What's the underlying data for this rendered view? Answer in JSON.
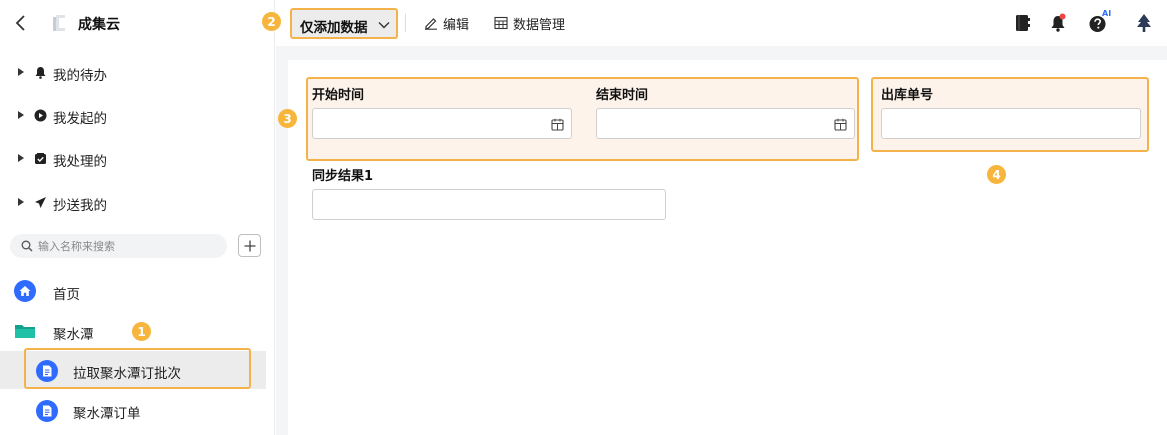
{
  "app": {
    "name": "成集云"
  },
  "sidebar": {
    "groups": [
      {
        "label": "我的待办",
        "icon": "bell-icon"
      },
      {
        "label": "我发起的",
        "icon": "play-circle-icon"
      },
      {
        "label": "我处理的",
        "icon": "check-box-icon"
      },
      {
        "label": "抄送我的",
        "icon": "send-icon"
      }
    ],
    "search": {
      "placeholder": "输入名称来搜索",
      "value": ""
    },
    "home_label": "首页",
    "folder_label": "聚水潭",
    "items": [
      {
        "label": "拉取聚水潭订批次",
        "selected": true
      },
      {
        "label": "聚水潭订单",
        "selected": false
      }
    ]
  },
  "toolbar": {
    "view_label": "仅添加数据",
    "edit_label": "编辑",
    "data_manage_label": "数据管理",
    "ai_badge": "AI"
  },
  "form": {
    "start_time": {
      "label": "开始时间",
      "value": ""
    },
    "end_time": {
      "label": "结束时间",
      "value": ""
    },
    "outbound_no": {
      "label": "出库单号",
      "value": ""
    },
    "sync_result": {
      "label": "同步结果1",
      "value": ""
    }
  },
  "annotations": [
    "1",
    "2",
    "3",
    "4"
  ],
  "colors": {
    "accent": "#f4b34a",
    "badge": "#f7b53b",
    "brand_blue": "#2f6bff",
    "folder": "#1aa7a0"
  }
}
